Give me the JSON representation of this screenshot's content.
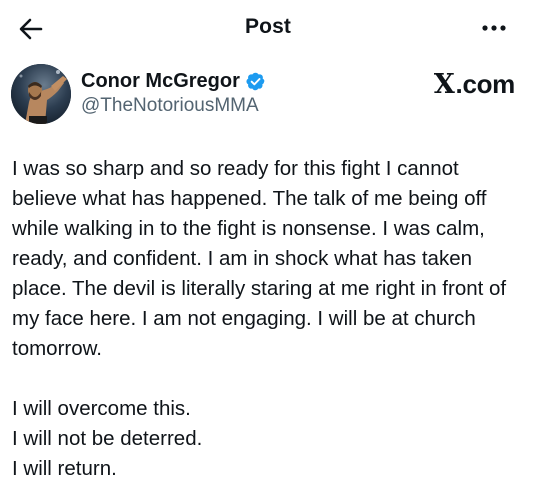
{
  "header": {
    "title": "Post",
    "back_icon": "arrow-left-icon",
    "more_icon": "more-horizontal-icon"
  },
  "author": {
    "display_name": "Conor McGregor",
    "handle": "@TheNotoriousMMA",
    "verified": true,
    "verified_color": "#1d9bf0"
  },
  "watermark": {
    "text": ".com",
    "logo": "X"
  },
  "post": {
    "paragraph_1": "I was so sharp and so ready for this fight I cannot believe what has happened. The talk of me being off while walking in to the fight is nonsense. I was calm, ready, and confident. I am in shock what has taken place. The devil is literally staring at me right in front of my face here. I am not engaging. I will be at church tomorrow.",
    "lines": [
      "I will overcome this.",
      "I will not be deterred.",
      "I will return."
    ]
  },
  "colors": {
    "text_primary": "#0f1419",
    "text_secondary": "#536471",
    "background": "#ffffff"
  }
}
